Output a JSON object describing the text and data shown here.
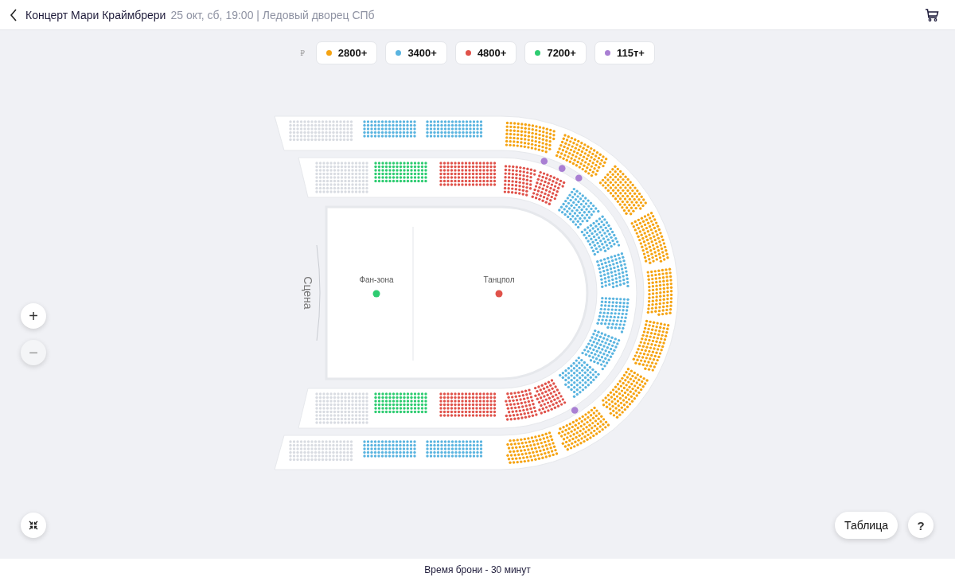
{
  "header": {
    "title": "Концерт Мари Краймбрери",
    "details": "25 окт, сб, 19:00 | Ледовый дворец СПб"
  },
  "currency": "₽",
  "prices": [
    {
      "label": "2800+",
      "color": "#f5a312"
    },
    {
      "label": "3400+",
      "color": "#5ab4e0"
    },
    {
      "label": "4800+",
      "color": "#e0524a"
    },
    {
      "label": "7200+",
      "color": "#2ecc71"
    },
    {
      "label": "115т+",
      "color": "#a97fd3"
    }
  ],
  "map": {
    "stage": "Сцена",
    "zones": [
      {
        "label": "Фан-зона",
        "color": "#2ecc71"
      },
      {
        "label": "Танцпол",
        "color": "#e0524a"
      }
    ]
  },
  "controls": {
    "zoom_in": "+",
    "zoom_out": "−",
    "table": "Таблица",
    "help": "?"
  },
  "footer": "Время брони - 30 минут"
}
